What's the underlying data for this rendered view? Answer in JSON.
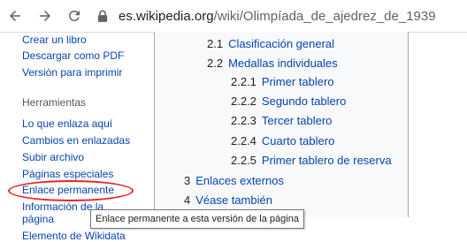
{
  "browser": {
    "url_host": "es.wikipedia.org",
    "url_path": "/wiki/Olimpíada_de_ajedrez_de_1939"
  },
  "sidebar": {
    "links_top": [
      {
        "label": "Crear un libro"
      },
      {
        "label": "Descargar como PDF"
      },
      {
        "label": "Versión para imprimir"
      }
    ],
    "tools_heading": "Herramientas",
    "tools": [
      {
        "label": "Lo que enlaza aquí"
      },
      {
        "label": "Cambios en enlazadas"
      },
      {
        "label": "Subir archivo"
      },
      {
        "label": "Páginas especiales"
      },
      {
        "label": "Enlace permanente"
      },
      {
        "label": "Información de la"
      },
      {
        "label": "página"
      },
      {
        "label": "Elemento de Wikidata"
      }
    ]
  },
  "toc": {
    "items": [
      {
        "num": "2.1",
        "text": "Clasificación general"
      },
      {
        "num": "2.2",
        "text": "Medallas individuales"
      },
      {
        "num": "2.2.1",
        "text": "Primer tablero"
      },
      {
        "num": "2.2.2",
        "text": "Segundo tablero"
      },
      {
        "num": "2.2.3",
        "text": "Tercer tablero"
      },
      {
        "num": "2.2.4",
        "text": "Cuarto tablero"
      },
      {
        "num": "2.2.5",
        "text": "Primer tablero de reserva"
      },
      {
        "num": "3",
        "text": "Enlaces externos"
      },
      {
        "num": "4",
        "text": "Véase también"
      }
    ]
  },
  "tooltip": {
    "text": "Enlace permanente a esta versión de la página"
  },
  "colors": {
    "link": "#0645ad",
    "highlight_ring": "#e8252a"
  }
}
